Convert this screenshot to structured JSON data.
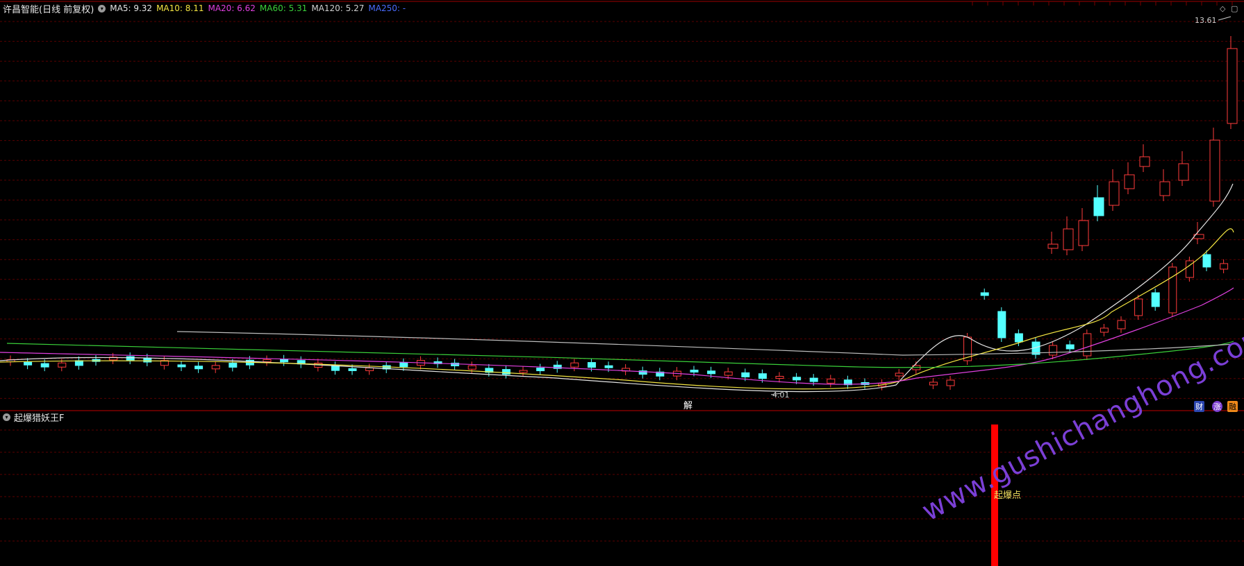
{
  "header": {
    "stock_title": "许昌智能(日线 前复权)",
    "ma": [
      {
        "label": "MA5: 9.32",
        "color": "#e6e6e6"
      },
      {
        "label": "MA10: 8.11",
        "color": "#f5e642"
      },
      {
        "label": "MA20: 6.62",
        "color": "#e040e0"
      },
      {
        "label": "MA60: 5.31",
        "color": "#3ad13a"
      },
      {
        "label": "MA120: 5.27",
        "color": "#d0d0d0"
      },
      {
        "label": "MA250: -",
        "color": "#4a6cff"
      }
    ]
  },
  "main_chart": {
    "high_label": "13.61",
    "low_label": "4.01",
    "annotation_jie": "解",
    "badge_cai": "财",
    "badge_zhang": "涨",
    "badge_rong": "融",
    "colors": {
      "up": "#ff3b3b",
      "down": "#54ffff",
      "grid": "#5a0000",
      "border": "#c00000"
    }
  },
  "sub_chart": {
    "title": "起爆猎妖王F",
    "signal_label": "起爆点",
    "signal_color": "#ff0000"
  },
  "watermark": "www.gushichanghong.com"
}
